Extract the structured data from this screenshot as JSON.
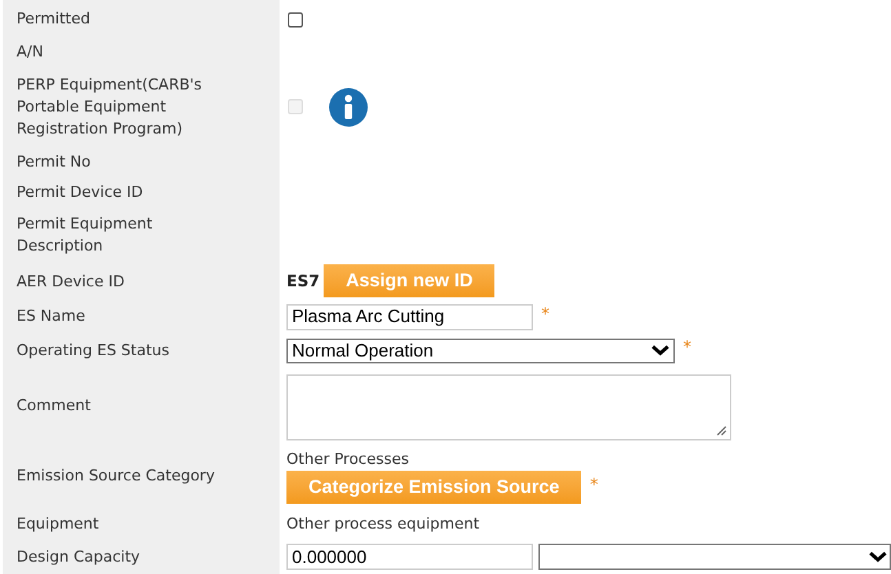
{
  "rows": [
    {
      "label": "Permitted",
      "kind": "checkbox",
      "checked": false,
      "disabled": false
    },
    {
      "label": "A/N",
      "kind": "empty"
    },
    {
      "label": "PERP Equipment(CARB's Portable Equipment Registration Program)",
      "kind": "checkbox_info",
      "checked": false,
      "disabled": true
    },
    {
      "label": "Permit No",
      "kind": "empty"
    },
    {
      "label": "Permit Device ID",
      "kind": "empty"
    },
    {
      "label": "Permit Equipment Description",
      "kind": "empty"
    },
    {
      "label": "AER Device ID",
      "kind": "id",
      "value": "ES7",
      "button": "Assign new ID"
    },
    {
      "label": "ES Name",
      "kind": "input",
      "value": "Plasma Arc Cutting",
      "required": "*"
    },
    {
      "label": "Operating ES Status",
      "kind": "select",
      "value": "Normal Operation",
      "required": "*"
    },
    {
      "label": "Comment",
      "kind": "textarea"
    },
    {
      "label": "Emission Source Category",
      "kind": "category",
      "value": "Other Processes",
      "button": "Categorize Emission Source",
      "required": "*"
    },
    {
      "label": "Equipment",
      "kind": "text",
      "value": "Other process equipment"
    },
    {
      "label": "Design Capacity",
      "kind": "capacity",
      "value": "0.000000"
    }
  ]
}
